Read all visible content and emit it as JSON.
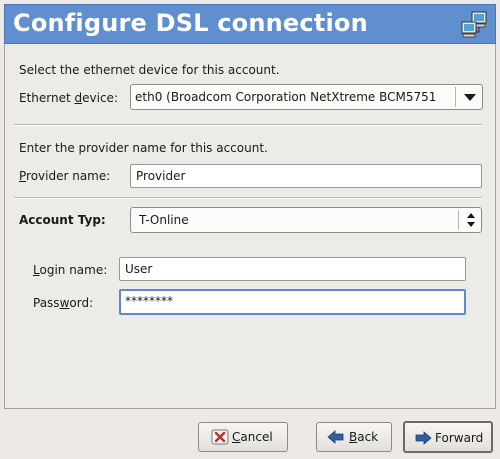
{
  "header": {
    "title": "Configure DSL connection",
    "icon": "network-computers-icon"
  },
  "ethernet": {
    "instruction": "Select the ethernet device for this account.",
    "label_pre": "Ethernet ",
    "label_mnemonic": "d",
    "label_post": "evice:",
    "selected_value": "eth0 (Broadcom Corporation NetXtreme BCM5751"
  },
  "provider": {
    "instruction": "Enter the provider name for this account.",
    "label_mnemonic": "P",
    "label_post": "rovider name:",
    "value": "Provider"
  },
  "account_type": {
    "label": "Account Typ:",
    "selected_value": "T-Online"
  },
  "login": {
    "label_mnemonic": "L",
    "label_post": "ogin name:",
    "value": "User"
  },
  "password": {
    "label_pre": "Pass",
    "label_mnemonic": "w",
    "label_post": "ord:",
    "value": "********"
  },
  "buttons": {
    "cancel_mnemonic": "C",
    "cancel_post": "ancel",
    "back_mnemonic": "B",
    "back_post": "ack",
    "forward_label": "Forward"
  },
  "colors": {
    "header_bg": "#5f8fcf",
    "focus_border": "#5a8ad0",
    "cancel_icon": "#c0302a",
    "arrow_icon": "#2f5f9e"
  }
}
